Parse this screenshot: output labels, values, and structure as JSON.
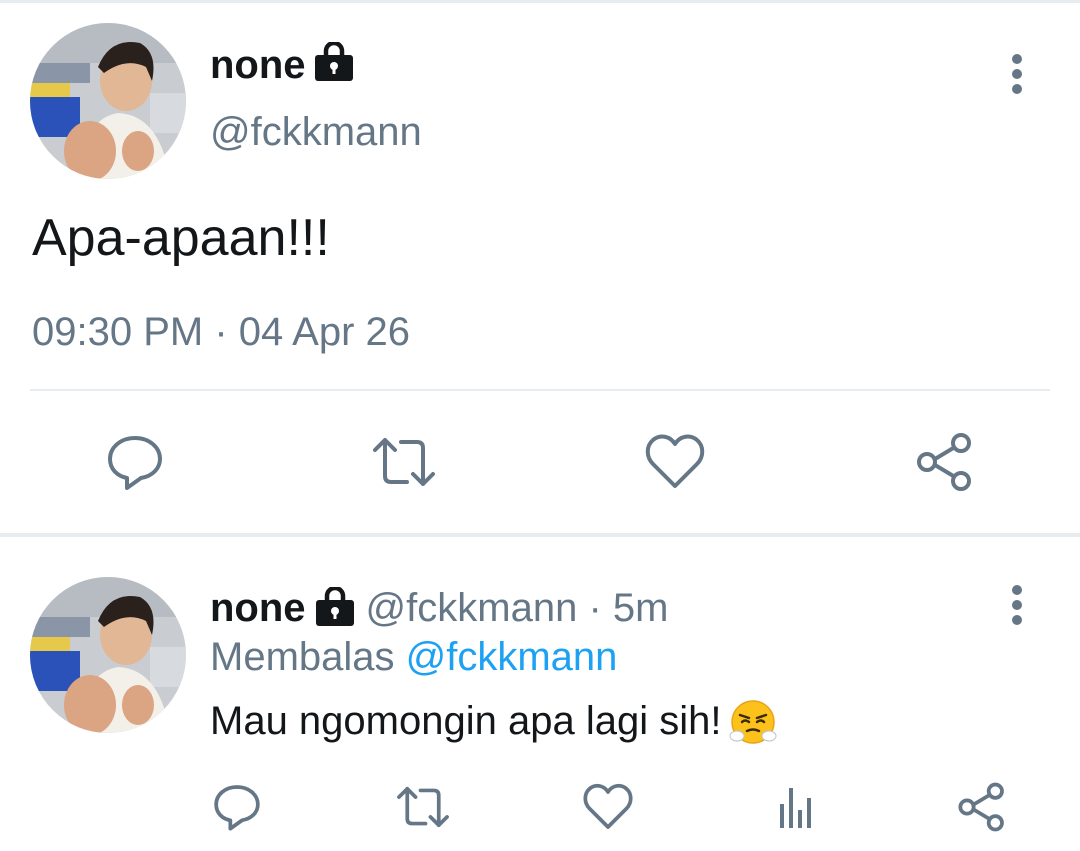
{
  "main_tweet": {
    "display_name": "none",
    "handle": "@fckkmann",
    "body": "Apa-apaan!!!",
    "timestamp": "09:30 PM · 04 Apr 26",
    "actions": [
      "reply-icon",
      "retweet-icon",
      "like-icon",
      "share-icon"
    ]
  },
  "reply_tweet": {
    "display_name": "none",
    "handle": "@fckkmann",
    "separator": " · ",
    "age": "5m",
    "replying_label": "Membalas",
    "replying_to": "@fckkmann",
    "body": "Mau ngomongin apa lagi sih!",
    "emoji": "face-with-steam-from-nose",
    "actions": [
      "reply-icon",
      "retweet-icon",
      "like-icon",
      "analytics-icon",
      "share-icon"
    ]
  },
  "colors": {
    "text_primary": "#14171a",
    "text_secondary": "#657786",
    "link": "#1da1f2",
    "divider": "#e6ecf0",
    "icon": "#657786"
  }
}
